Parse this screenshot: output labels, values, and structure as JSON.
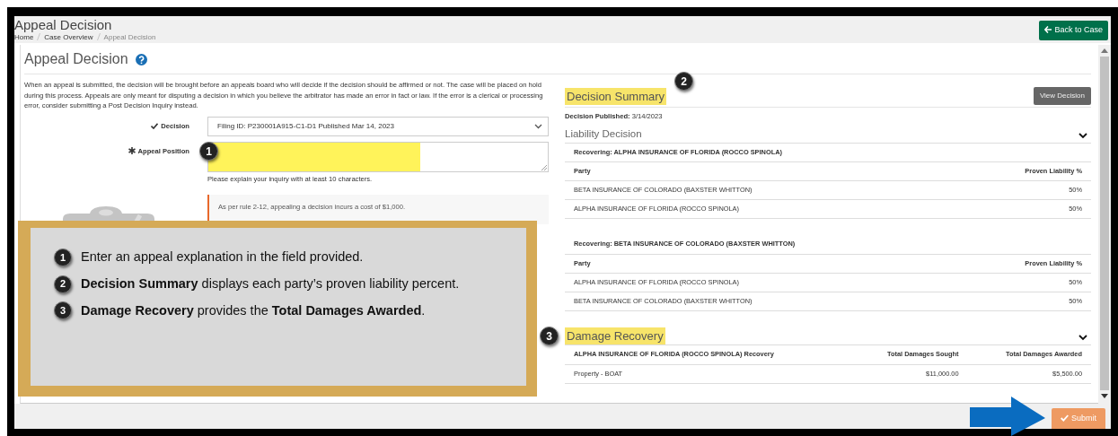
{
  "header": {
    "title": "Appeal Decision",
    "breadcrumb": [
      {
        "label": "Home"
      },
      {
        "label": "Case Overview"
      },
      {
        "label": "Appeal Decision"
      }
    ],
    "back_button": "Back to Case"
  },
  "panel": {
    "title": "Appeal Decision",
    "intro": "When an appeal is submitted, the decision will be brought before an appeals board who will decide if the decision should be affirmed or not. The case will be placed on hold during this process. Appeals are only meant for disputing a decision in which you believe the arbitrator has made an error in fact or law. If the error is a clerical or processing error, consider submitting a Post Decision Inquiry instead.",
    "decision": {
      "label": "Decision",
      "value": "Filing ID: P230001A915-C1-D1 Published Mar 14, 2023"
    },
    "appeal": {
      "label": "Appeal Position",
      "required": true,
      "highlighted": true,
      "help": "Please explain your inquiry with at least 10 characters."
    },
    "notice": "As per rule 2-12, appealing a decision incurs a cost of $1,000."
  },
  "summary": {
    "title": "Decision Summary",
    "highlighted": true,
    "view_button": "View Decision",
    "published_label": "Decision Published:",
    "published_value": "3/14/2023",
    "liability": {
      "title": "Liability Decision",
      "expanded": true,
      "groups": [
        {
          "heading": "Recovering: ALPHA INSURANCE OF FLORIDA (ROCCO SPINOLA)",
          "columns": [
            "Party",
            "Proven Liability %"
          ],
          "rows": [
            [
              "BETA INSURANCE OF COLORADO (BAXSTER WHITTON)",
              "50%"
            ],
            [
              "ALPHA INSURANCE OF FLORIDA (ROCCO SPINOLA)",
              "50%"
            ]
          ]
        },
        {
          "heading": "Recovering: BETA INSURANCE OF COLORADO (BAXSTER WHITTON)",
          "columns": [
            "Party",
            "Proven Liability %"
          ],
          "rows": [
            [
              "ALPHA INSURANCE OF FLORIDA (ROCCO SPINOLA)",
              "50%"
            ],
            [
              "BETA INSURANCE OF COLORADO (BAXSTER WHITTON)",
              "50%"
            ]
          ]
        }
      ]
    },
    "damage": {
      "title": "Damage Recovery",
      "highlighted": true,
      "expanded": true,
      "columns": [
        "ALPHA INSURANCE OF FLORIDA (ROCCO SPINOLA) Recovery",
        "Total Damages Sought",
        "Total Damages Awarded"
      ],
      "rows": [
        [
          "Property - BOAT",
          "$11,000.00",
          "$5,500.00"
        ]
      ]
    }
  },
  "footer": {
    "submit": "Submit"
  },
  "callouts": [
    {
      "number": "1"
    },
    {
      "number": "2"
    },
    {
      "number": "3"
    }
  ],
  "tips": [
    {
      "number": "1",
      "text": "Enter an appeal explanation in the field provided."
    },
    {
      "number": "2",
      "text": "**Decision Summary** displays each party’s proven liability percent."
    },
    {
      "number": "3",
      "text": "**Damage Recovery** provides the **Total Damages Awarded**."
    }
  ]
}
